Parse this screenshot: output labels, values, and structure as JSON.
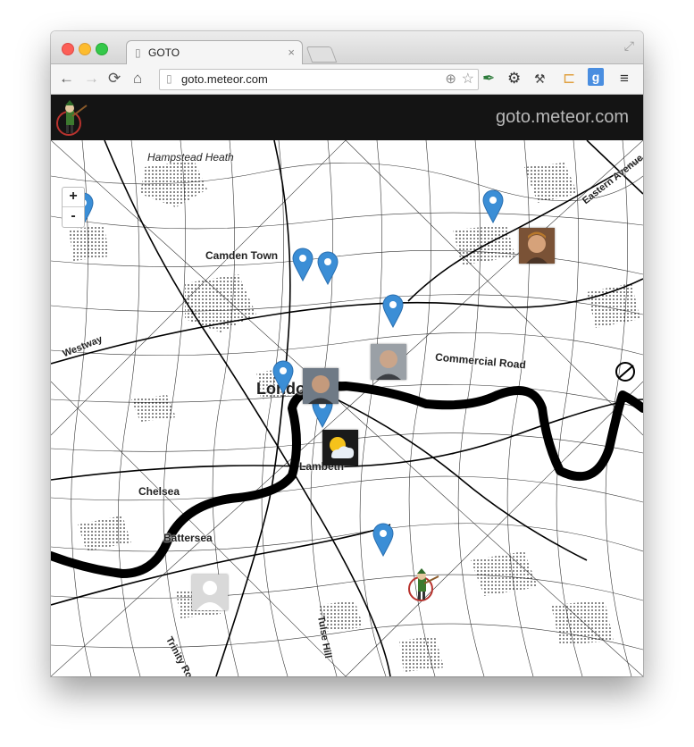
{
  "browser": {
    "tab_title": "GOTO",
    "tab_close": "×",
    "url": "goto.meteor.com",
    "nav": {
      "back": "←",
      "forward": "→",
      "reload": "⟳",
      "home": "⌂"
    },
    "toolbar_icons": {
      "pen": "✒",
      "gear": "⚙",
      "wrench": "🔧",
      "ext1": "⊏",
      "ext2": "g",
      "menu": "≡"
    }
  },
  "header": {
    "brand": "goto.meteor.com"
  },
  "zoom": {
    "in": "+",
    "out": "-"
  },
  "map": {
    "labels": {
      "hampstead": "Hampstead Heath",
      "camden": "Camden Town",
      "westway": "Westway",
      "commercial": "Commercial Road",
      "eastern": "Eastern Avenue",
      "london": "London",
      "lambeth": "Lambeth",
      "chelsea": "Chelsea",
      "battersea": "Battersea",
      "tulse": "Tulse Hill",
      "trinity": "Trinity Ro"
    },
    "pin_color": "#3b8ed6",
    "pin_count": 9,
    "avatar_count": 6
  }
}
